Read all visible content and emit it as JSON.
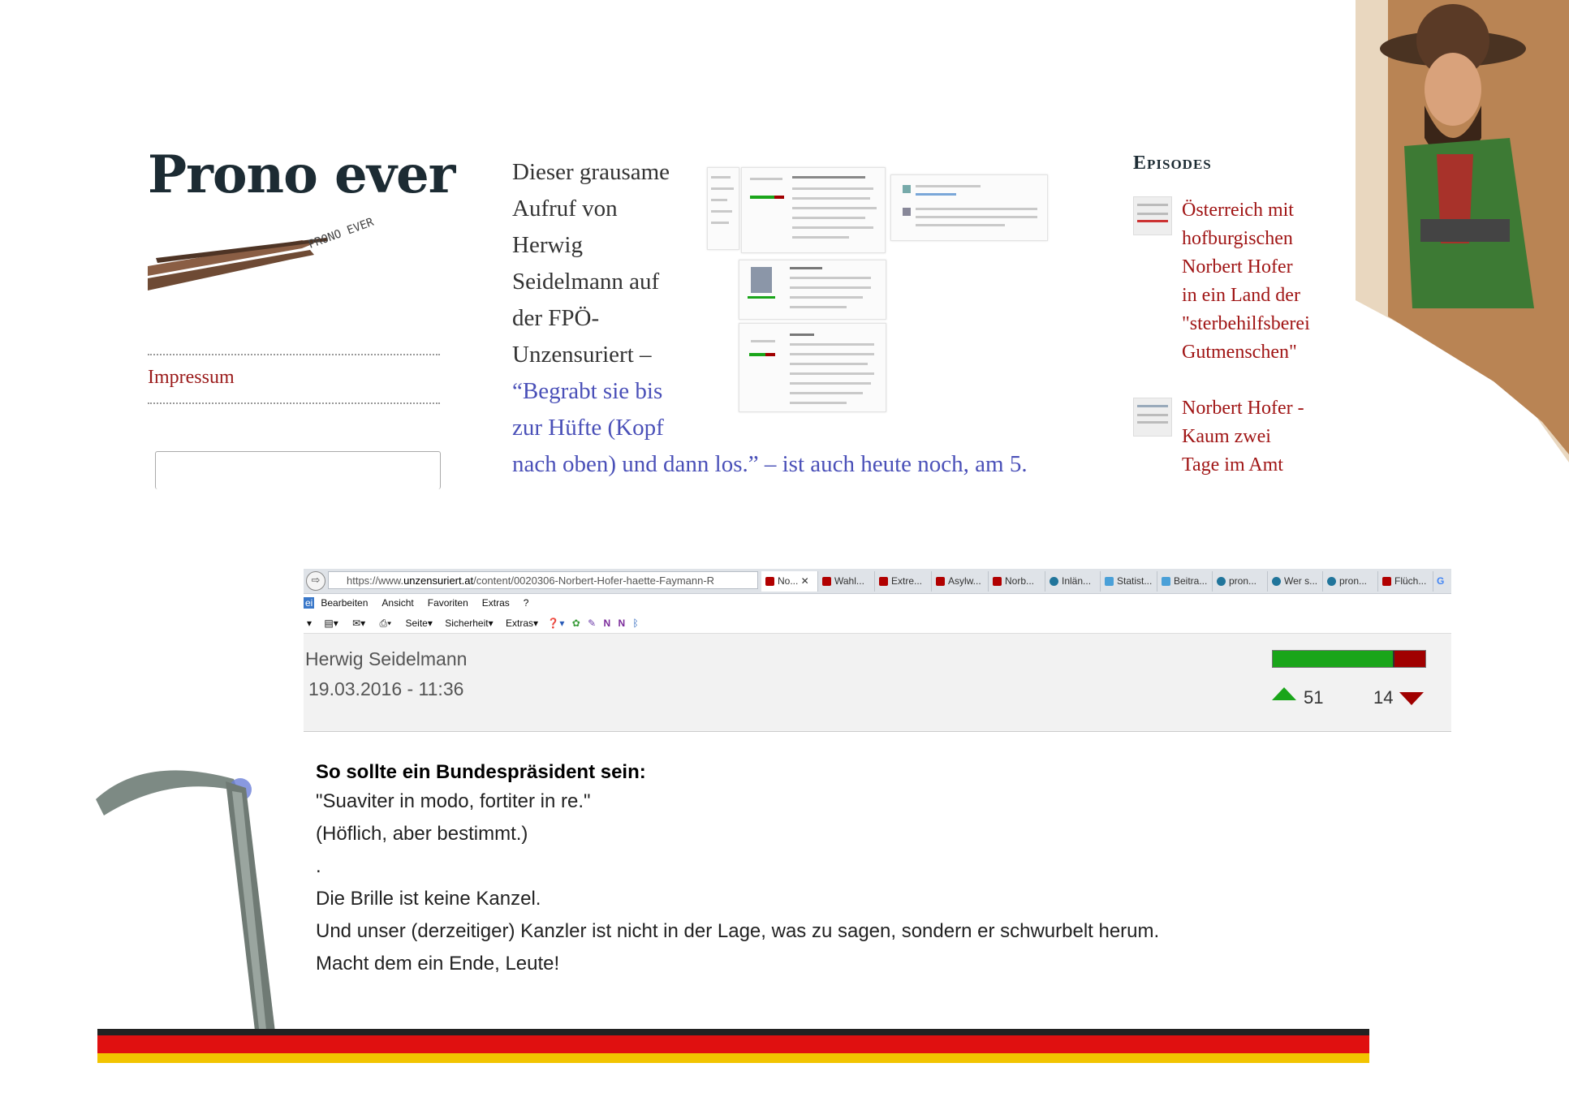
{
  "site": {
    "title": "Prono ever",
    "logo_text": "PRONO EVER",
    "nav": [
      "Impressum"
    ]
  },
  "excerpt": {
    "lead_lines": [
      "Dieser grausame",
      "Aufruf von",
      "Herwig",
      "Seidelmann auf",
      "der FPÖ-",
      "Unzensuriert –"
    ],
    "quote_lines": [
      "“Begrabt sie bis",
      "zur Hüfte (Kopf"
    ],
    "last_line_quote": "nach oben) und dann los.”",
    "last_line_rest": " – ist auch heute noch, am 5."
  },
  "episodes": {
    "heading": "Episodes",
    "items": [
      {
        "lines": [
          "Österreich mit",
          "hofburgischen",
          "Norbert Hofer",
          "in ein Land der",
          "\"sterbehilfsberei",
          "Gutmenschen\""
        ]
      },
      {
        "lines": [
          "Norbert Hofer -",
          "Kaum zwei",
          "Tage im Amt"
        ]
      }
    ]
  },
  "browser": {
    "url_prefix": "https://www.",
    "url_domain": "unzensuriert.at",
    "url_path": "/content/0020306-Norbert-Hofer-haette-Faymann-R",
    "tabs": [
      "No...",
      "Wahl...",
      "Extre...",
      "Asylw...",
      "Norb...",
      "Inlän...",
      "Statist...",
      "Beitra...",
      "pron...",
      "Wer s...",
      "pron...",
      "Flüch..."
    ],
    "menu": [
      "ei",
      "Bearbeiten",
      "Ansicht",
      "Favoriten",
      "Extras",
      "?"
    ],
    "commands": [
      "Seite",
      "Sicherheit",
      "Extras"
    ],
    "author": "Herwig Seidelmann",
    "date": "19.03.2016 - 11:36",
    "votes_up": "51",
    "votes_down": "14",
    "vote_up_share": 0.785
  },
  "comment": {
    "heading": "So sollte ein Bundespräsident sein:",
    "lines": [
      "\"Suaviter in modo, fortiter in re.\"",
      "(Höflich, aber bestimmt.)",
      ".",
      "Die Brille ist keine Kanzel.",
      "Und unser (derzeitiger) Kanzler ist nicht in der Lage, was zu sagen, sondern er schwurbelt herum.",
      "Macht dem ein Ende, Leute!"
    ]
  },
  "colors": {
    "title": "#1c2b33",
    "link_red": "#a01515",
    "quote_blue": "#4a50b8",
    "vote_green": "#1aa51a",
    "vote_red": "#a00000"
  }
}
